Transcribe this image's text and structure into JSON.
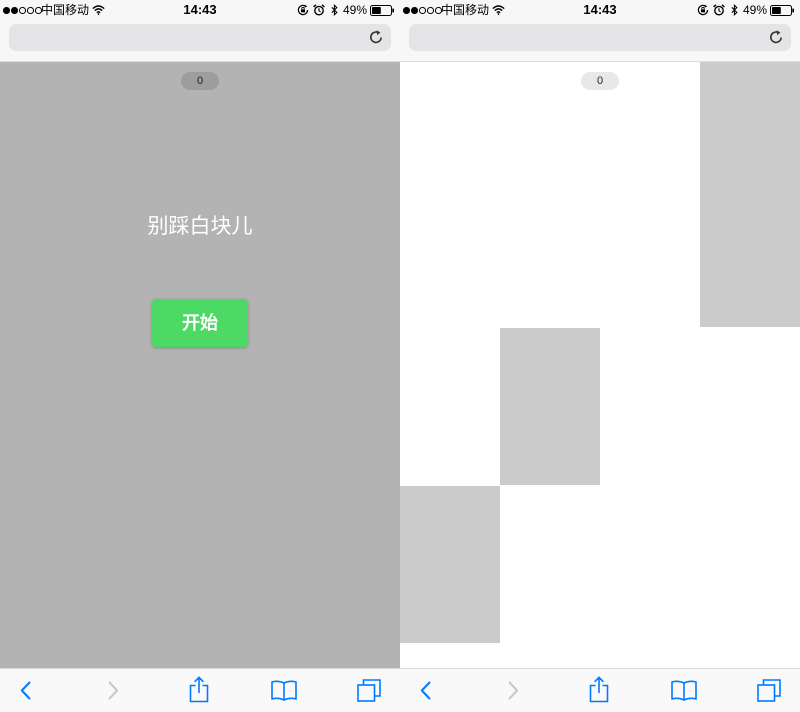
{
  "screens": [
    {
      "status_bar": {
        "signal_bars": 2,
        "signal_total": 5,
        "carrier": "中国移动",
        "time": "14:43",
        "battery_text": "49%",
        "battery_level": 49
      },
      "score": "0",
      "title": "别踩白块儿",
      "start_button": "开始"
    },
    {
      "status_bar": {
        "signal_bars": 2,
        "signal_total": 5,
        "carrier": "中国移动",
        "time": "14:43",
        "battery_text": "49%",
        "battery_level": 49
      },
      "score": "0"
    }
  ],
  "status_icons": [
    "wifi-icon",
    "orientation-lock-icon",
    "alarm-icon",
    "bluetooth-icon",
    "battery-icon"
  ],
  "address_bar_icon": "refresh-icon",
  "toolbar_icons": [
    "back-icon",
    "forward-icon",
    "share-icon",
    "bookmarks-icon",
    "tabs-icon"
  ],
  "colors": {
    "accent": "#007aff",
    "disabled": "#c7c7cc",
    "start_button": "#4cd964",
    "overlay": "#b3b3b3",
    "tile": "#cbcbcb"
  }
}
